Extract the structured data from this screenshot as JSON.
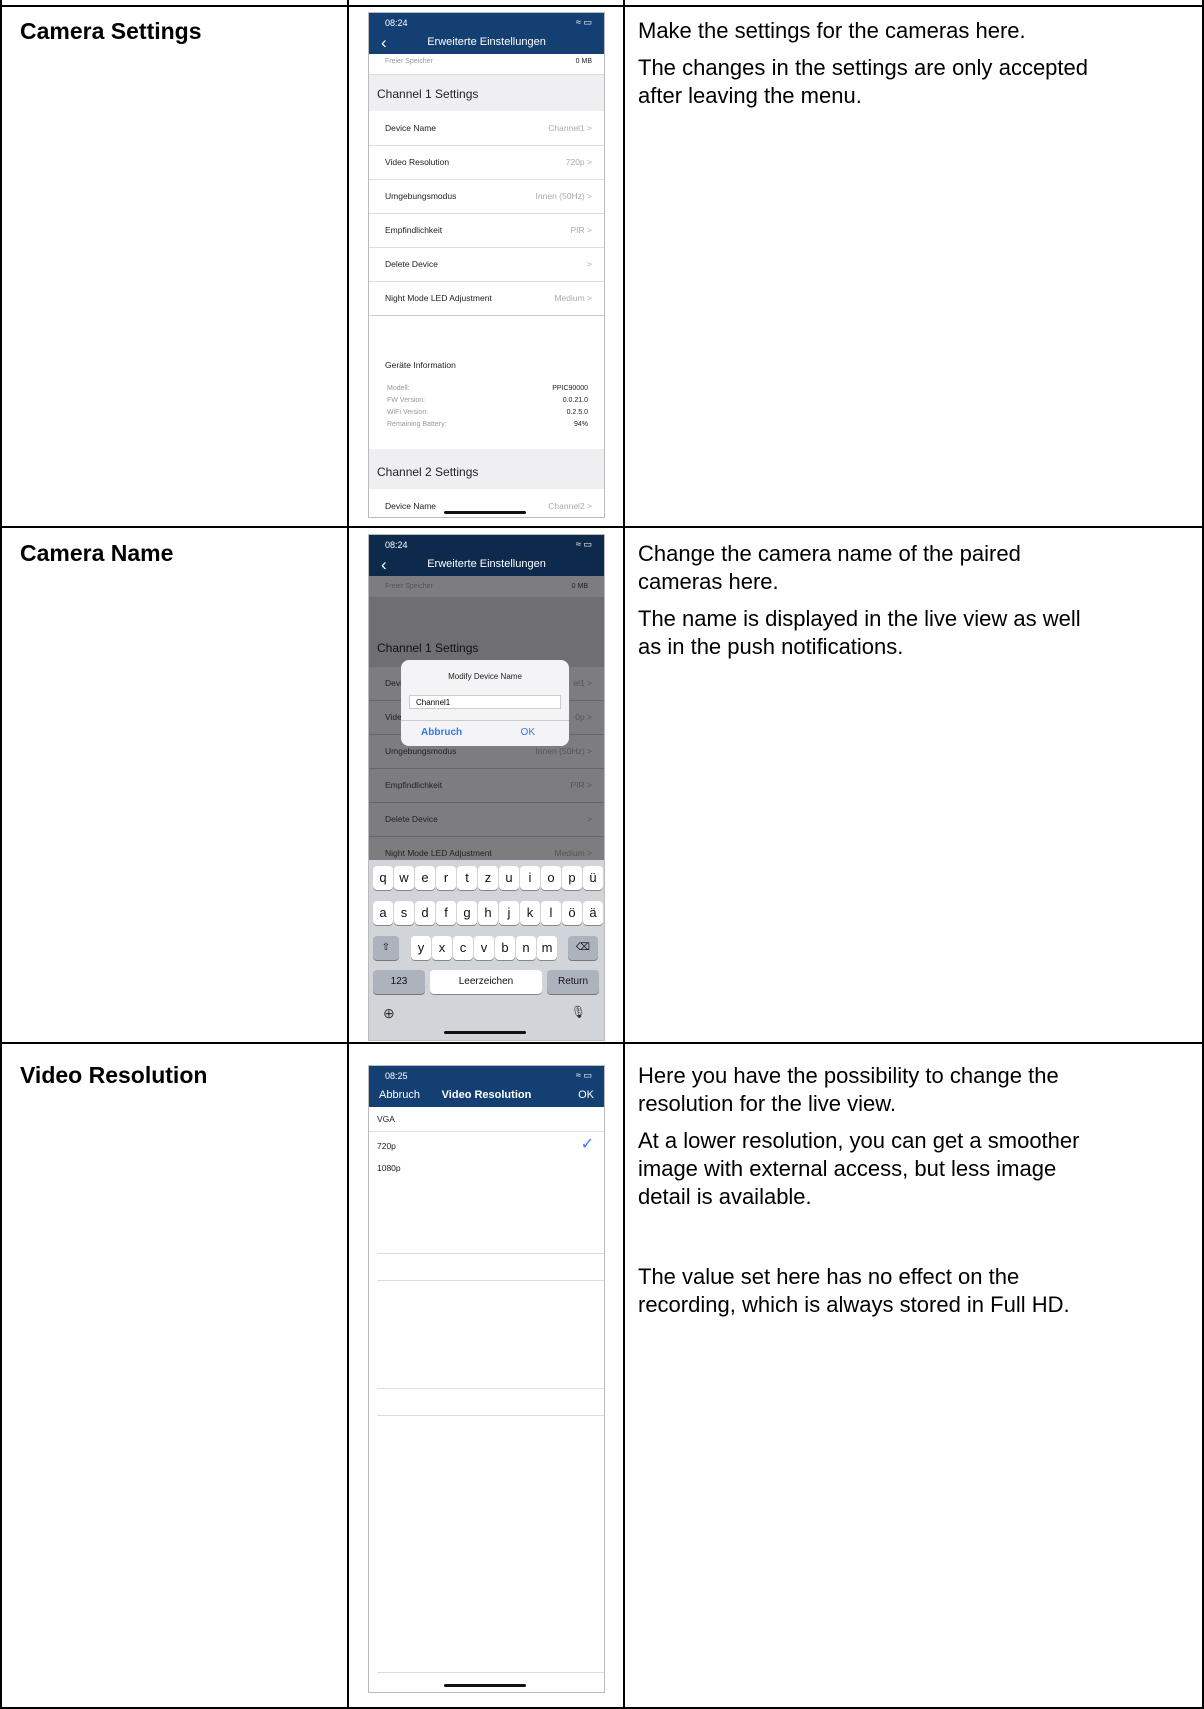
{
  "rows": [
    {
      "label": "Camera Settings",
      "desc": [
        "Make the settings for the cameras here.",
        "The changes in the settings are only accepted after leaving the menu."
      ]
    },
    {
      "label": "Camera Name",
      "desc": [
        "Change the camera name of the paired cameras here.",
        "The name is displayed in the live view as well as in the push notifications."
      ]
    },
    {
      "label": "Video Resolution",
      "desc": [
        "Here you have the possibility to change the resolution for the live view.",
        "At a lower resolution, you can get a smoother image with external access, but less image detail is available.",
        "The value set here has no effect on the recording, which is always stored in Full HD."
      ]
    }
  ],
  "screen1": {
    "time": "08:24",
    "title": "Erweiterte Einstellungen",
    "free_label": "Freier Speicher",
    "free_value": "0 MB",
    "ch1": "Channel 1 Settings",
    "items": [
      {
        "label": "Device Name",
        "value": "Channel1 >"
      },
      {
        "label": "Video Resolution",
        "value": "720p >"
      },
      {
        "label": "Umgebungsmodus",
        "value": "Innen (50Hz) >"
      },
      {
        "label": "Empfindlichkeit",
        "value": "PIR >"
      },
      {
        "label": "Delete Device",
        "value": ">"
      },
      {
        "label": "Night Mode LED Adjustment",
        "value": "Medium >"
      }
    ],
    "info_title": "Geräte Information",
    "info": [
      {
        "label": "Modell:",
        "value": "PPIC90000"
      },
      {
        "label": "FW Version:",
        "value": "0.0.21.0"
      },
      {
        "label": "WiFi Version:",
        "value": "0.2.5.0"
      },
      {
        "label": "Remaining Battery:",
        "value": "94%"
      }
    ],
    "ch2": "Channel 2 Settings",
    "ch2_item": {
      "label": "Device Name",
      "value": "Channel2 >"
    }
  },
  "screen2": {
    "time": "08:24",
    "title": "Erweiterte Einstellungen",
    "free_label": "Freier Speicher",
    "free_value": "0 MB",
    "ch1": "Channel 1 Settings",
    "dialog_title": "Modify Device Name",
    "dialog_value": "Channel1",
    "cancel": "Abbruch",
    "ok": "OK",
    "items": [
      {
        "label": "Devi",
        "value": "el1 >"
      },
      {
        "label": "Vide",
        "value": "0p >"
      },
      {
        "label": "Umgebungsmodus",
        "value": "Innen (50Hz) >"
      },
      {
        "label": "Empfindlichkeit",
        "value": "PIR >"
      },
      {
        "label": "Delete Device",
        "value": ">"
      },
      {
        "label": "Night Mode LED Adjustment",
        "value": "Medium >"
      }
    ],
    "kb_row1": [
      "q",
      "w",
      "e",
      "r",
      "t",
      "z",
      "u",
      "i",
      "o",
      "p",
      "ü"
    ],
    "kb_row2": [
      "a",
      "s",
      "d",
      "f",
      "g",
      "h",
      "j",
      "k",
      "l",
      "ö",
      "ä"
    ],
    "kb_row3": [
      "y",
      "x",
      "c",
      "v",
      "b",
      "n",
      "m"
    ],
    "kb_123": "123",
    "kb_space": "Leerzeichen",
    "kb_return": "Return"
  },
  "screen3": {
    "time": "08:25",
    "cancel": "Abbruch",
    "title": "Video Resolution",
    "ok": "OK",
    "options": [
      "VGA",
      "720p",
      "1080p"
    ],
    "selected": "720p"
  },
  "colors": {
    "nav": "#143f73",
    "accent": "#3478f6"
  }
}
